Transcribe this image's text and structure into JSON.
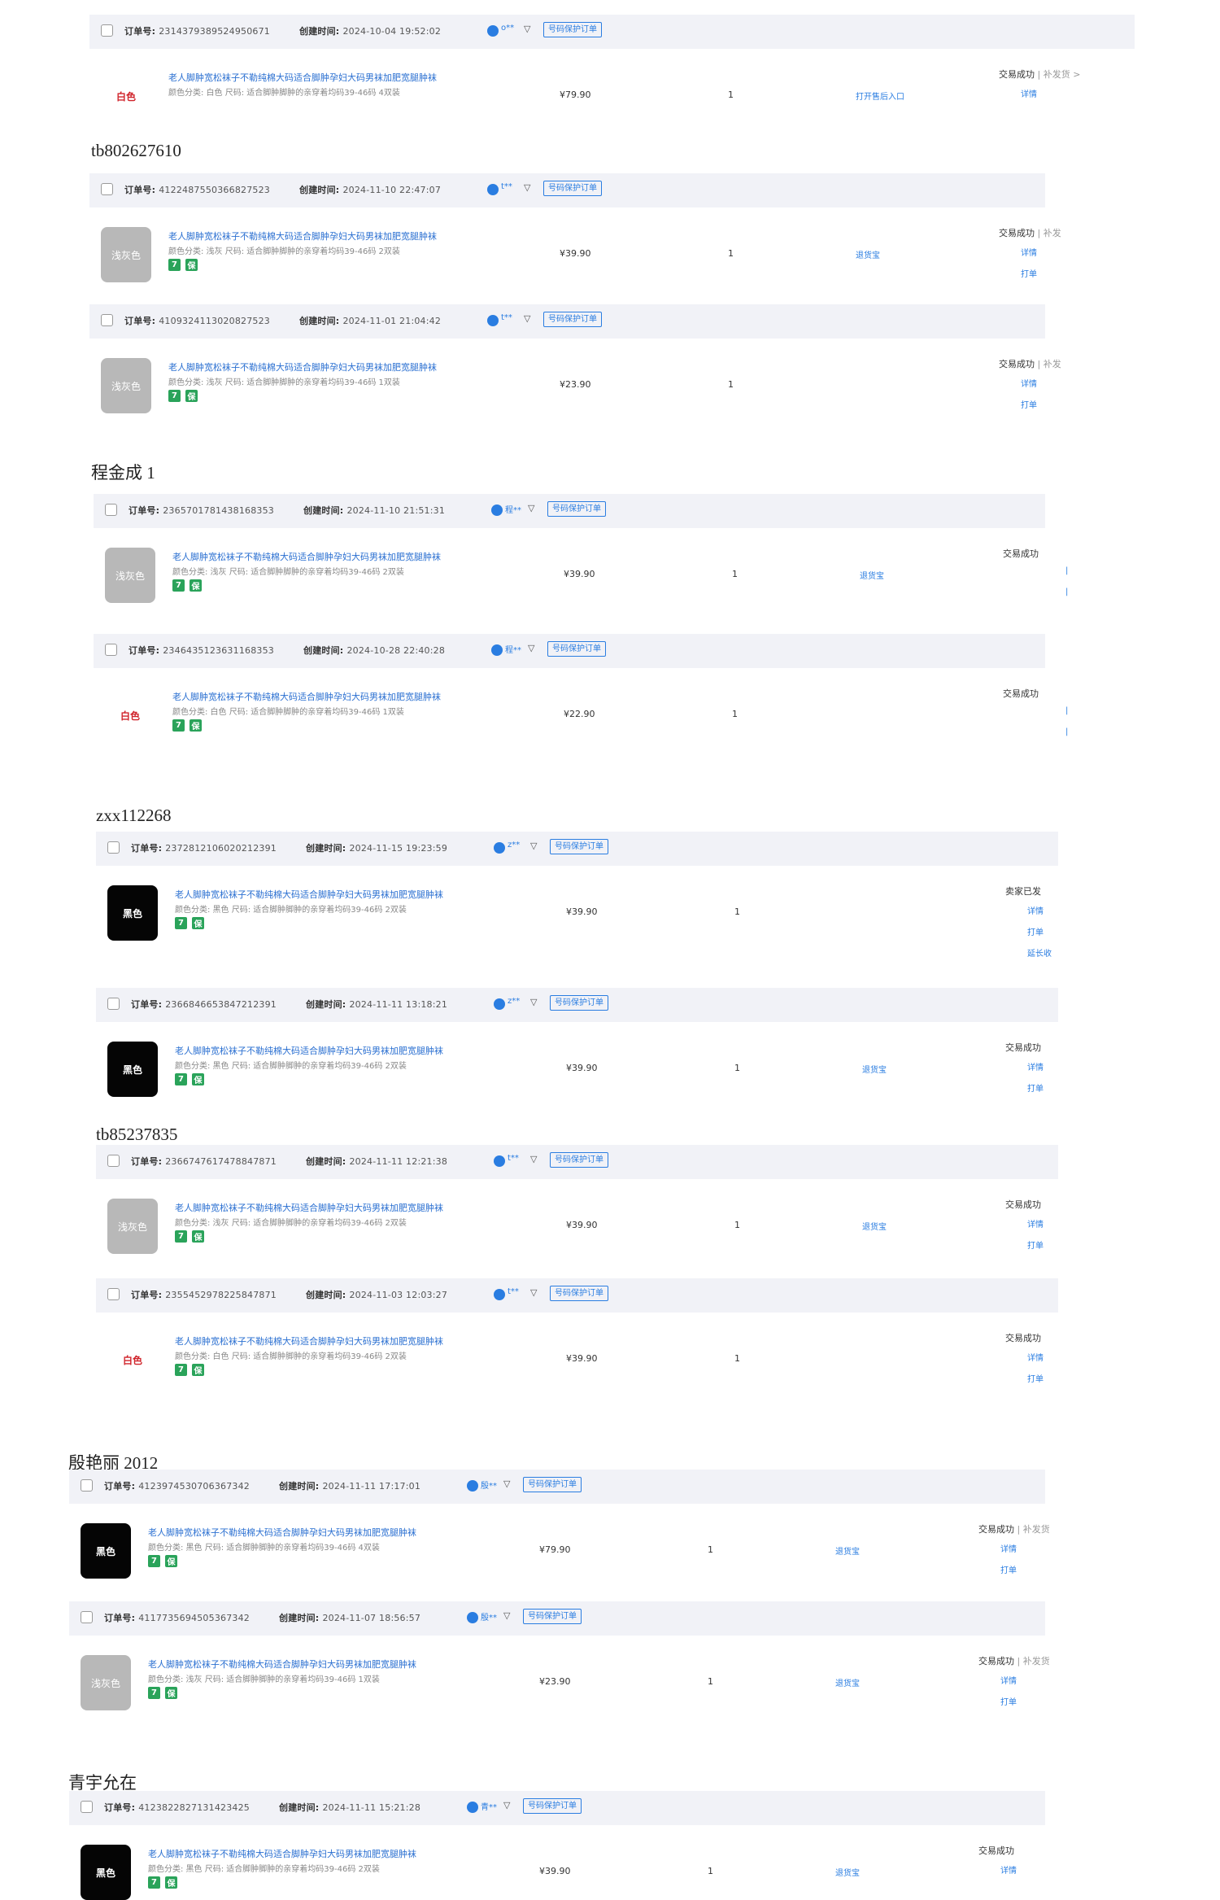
{
  "labels": {
    "order_no": "订单号:",
    "created": "创建时间:",
    "filter_icon": "▽",
    "protect_badge": "号码保护订单",
    "product_name": "老人脚肿宽松袜子不勒纯棉大码适合脚肿孕妇大码男袜加肥宽腿肿袜",
    "sku_prefix": "颜色分类:",
    "size_prefix": "尺码:",
    "size_desc": "适合脚肿脚肿的亲穿着均码39-46码",
    "qty": "1",
    "tag_7": "7",
    "tag_hb": "保",
    "link_entry": "打开售后入口",
    "link_return": "退货宝",
    "detail": "详情",
    "print": "打单",
    "extend": "延长收",
    "st_success": "交易成功",
    "st_shipped": "卖家已发",
    "st_sep": " | ",
    "st_resend": "补发货 >",
    "st_resend_short": "补发"
  },
  "groups": [
    {
      "title": "",
      "orders": [
        {
          "order_no": "2314379389524950671",
          "created": "2024-10-04 19:52:02",
          "buyer": "o**",
          "thumb": "白色",
          "thumb_style": "white",
          "sku_color": "白色",
          "sku_qty": "4双装",
          "price": "¥79.90",
          "status": "st_success",
          "extra": "补发货 >",
          "mid": "打开售后入口",
          "actions": [
            "详情"
          ]
        }
      ]
    },
    {
      "title": "tb802627610",
      "orders": [
        {
          "order_no": "4122487550366827523",
          "created": "2024-11-10 22:47:07",
          "buyer": "t**",
          "thumb": "浅灰色",
          "thumb_style": "gray",
          "sku_color": "浅灰",
          "sku_qty": "2双装",
          "price": "¥39.90",
          "status": "st_success",
          "extra": "补发",
          "mid": "退货宝",
          "actions": [
            "详情",
            "打单"
          ]
        },
        {
          "order_no": "4109324113020827523",
          "created": "2024-11-01 21:04:42",
          "buyer": "t**",
          "thumb": "浅灰色",
          "thumb_style": "gray",
          "sku_color": "浅灰",
          "sku_qty": "1双装",
          "price": "¥23.90",
          "status": "st_success",
          "extra": "补发",
          "mid": "",
          "actions": [
            "详情",
            "打单"
          ]
        }
      ]
    },
    {
      "title": "程金成 1",
      "orders": [
        {
          "order_no": "2365701781438168353",
          "created": "2024-11-10 21:51:31",
          "buyer": "程**",
          "thumb": "浅灰色",
          "thumb_style": "gray",
          "sku_color": "浅灰",
          "sku_qty": "2双装",
          "price": "¥39.90",
          "status": "st_success",
          "extra": "",
          "mid": "退货宝",
          "actions": [
            "|",
            "|"
          ]
        },
        {
          "order_no": "2346435123631168353",
          "created": "2024-10-28 22:40:28",
          "buyer": "程**",
          "thumb": "白色",
          "thumb_style": "white",
          "sku_color": "白色",
          "sku_qty": "1双装",
          "price": "¥22.90",
          "status": "st_success",
          "extra": "",
          "mid": "",
          "actions": [
            "|",
            "|"
          ]
        }
      ]
    },
    {
      "title": "zxx112268",
      "orders": [
        {
          "order_no": "2372812106020212391",
          "created": "2024-11-15 19:23:59",
          "buyer": "z**",
          "thumb": "黑色",
          "thumb_style": "black",
          "sku_color": "黑色",
          "sku_qty": "2双装",
          "price": "¥39.90",
          "status": "st_shipped",
          "extra": "",
          "mid": "",
          "actions": [
            "详情",
            "打单",
            "延长收"
          ]
        },
        {
          "order_no": "2366846653847212391",
          "created": "2024-11-11 13:18:21",
          "buyer": "z**",
          "thumb": "黑色",
          "thumb_style": "black",
          "sku_color": "黑色",
          "sku_qty": "2双装",
          "price": "¥39.90",
          "status": "st_success",
          "extra": "",
          "mid": "退货宝",
          "actions": [
            "详情",
            "打单"
          ]
        }
      ]
    },
    {
      "title": "tb85237835",
      "orders": [
        {
          "order_no": "2366747617478847871",
          "created": "2024-11-11 12:21:38",
          "buyer": "t**",
          "thumb": "浅灰色",
          "thumb_style": "gray",
          "sku_color": "浅灰",
          "sku_qty": "2双装",
          "price": "¥39.90",
          "status": "st_success",
          "extra": "",
          "mid": "退货宝",
          "actions": [
            "详情",
            "打单"
          ]
        },
        {
          "order_no": "2355452978225847871",
          "created": "2024-11-03 12:03:27",
          "buyer": "t**",
          "thumb": "白色",
          "thumb_style": "white",
          "sku_color": "白色",
          "sku_qty": "2双装",
          "price": "¥39.90",
          "status": "st_success",
          "extra": "",
          "mid": "",
          "actions": [
            "详情",
            "打单"
          ]
        }
      ]
    },
    {
      "title": "殷艳丽 2012",
      "orders": [
        {
          "order_no": "4123974530706367342",
          "created": "2024-11-11 17:17:01",
          "buyer": "殷**",
          "thumb": "黑色",
          "thumb_style": "black",
          "sku_color": "黑色",
          "sku_qty": "4双装",
          "price": "¥79.90",
          "status": "st_success",
          "extra": "补发货",
          "mid": "退货宝",
          "actions": [
            "详情",
            "打单"
          ]
        },
        {
          "order_no": "4117735694505367342",
          "created": "2024-11-07 18:56:57",
          "buyer": "殷**",
          "thumb": "浅灰色",
          "thumb_style": "gray",
          "sku_color": "浅灰",
          "sku_qty": "1双装",
          "price": "¥23.90",
          "status": "st_success",
          "extra": "补发货",
          "mid": "退货宝",
          "actions": [
            "详情",
            "打单"
          ]
        }
      ]
    },
    {
      "title": "青宇允在",
      "orders": [
        {
          "order_no": "4123822827131423425",
          "created": "2024-11-11 15:21:28",
          "buyer": "青**",
          "thumb": "黑色",
          "thumb_style": "black",
          "sku_color": "黑色",
          "sku_qty": "2双装",
          "price": "¥39.90",
          "status": "st_success",
          "extra": "",
          "mid": "退货宝",
          "actions": [
            "详情"
          ]
        }
      ]
    }
  ]
}
